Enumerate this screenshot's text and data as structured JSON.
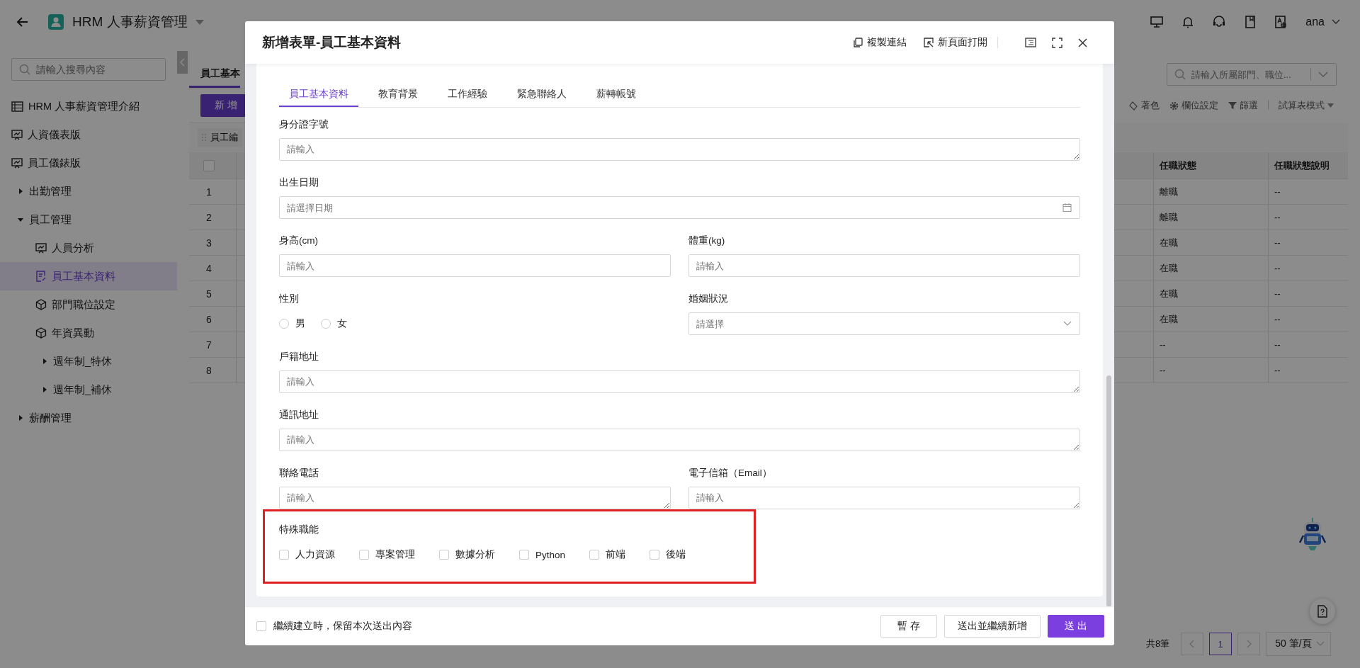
{
  "app_bar": {
    "title": "HRM 人事薪資管理",
    "user": "ana"
  },
  "sidebar": {
    "search_placeholder": "請輸入搜尋內容",
    "items": [
      {
        "label": "HRM 人事薪資管理介紹",
        "kind": "table",
        "selected": false
      },
      {
        "label": "人資儀表版",
        "kind": "dashboard",
        "selected": false
      },
      {
        "label": "員工儀錶版",
        "kind": "dashboard",
        "selected": false
      },
      {
        "label": "出勤管理",
        "kind": "folder",
        "expanded": false
      },
      {
        "label": "員工管理",
        "kind": "folder",
        "expanded": true,
        "children": [
          {
            "label": "人員分析",
            "kind": "dashboard",
            "selected": false
          },
          {
            "label": "員工基本資料",
            "kind": "form",
            "selected": true
          },
          {
            "label": "部門職位設定",
            "kind": "cube",
            "selected": false
          },
          {
            "label": "年資異動",
            "kind": "cube",
            "selected": false
          },
          {
            "label": "週年制_特休",
            "kind": "folder",
            "expanded": false
          },
          {
            "label": "週年制_補休",
            "kind": "folder",
            "expanded": false
          }
        ]
      },
      {
        "label": "薪酬管理",
        "kind": "folder",
        "expanded": false
      }
    ]
  },
  "background": {
    "tab": "員工基本",
    "add_button": "新 增",
    "column_chip": "員工編",
    "row_numbers": [
      "1",
      "2",
      "3",
      "4",
      "5",
      "6",
      "7",
      "8"
    ],
    "search_placeholder": "請輸入所屬部門、職位...",
    "select_all": {
      "checked": false
    },
    "toolbar": [
      {
        "label": "著色",
        "kind": "paint"
      },
      {
        "label": "欄位設定",
        "kind": "gear"
      },
      {
        "label": "篩選",
        "kind": "filter"
      },
      {
        "label": "試算表模式",
        "kind": "dropdown"
      }
    ],
    "table": {
      "columns": [
        "任職狀態",
        "任職狀態說明"
      ],
      "rows": [
        [
          "離職",
          "--"
        ],
        [
          "離職",
          "--"
        ],
        [
          "在職",
          "--"
        ],
        [
          "在職",
          "--"
        ],
        [
          "在職",
          "--"
        ],
        [
          "在職",
          "--"
        ],
        [
          "--",
          "--"
        ],
        [
          "--",
          "--"
        ]
      ]
    },
    "pagination": {
      "total": "共8筆",
      "pages": [
        {
          "label": "1",
          "selected": true
        }
      ],
      "page_size": "50 筆/頁"
    }
  },
  "modal": {
    "title": "新增表單-員工基本資料",
    "actions": [
      {
        "label": "複製連結",
        "kind": "copy"
      },
      {
        "label": "新頁面打開",
        "kind": "open"
      }
    ],
    "tabs": [
      {
        "label": "員工基本資料",
        "selected": true
      },
      {
        "label": "教育背景",
        "selected": false
      },
      {
        "label": "工作經驗",
        "selected": false
      },
      {
        "label": "緊急聯絡人",
        "selected": false
      },
      {
        "label": "薪轉帳號",
        "selected": false
      }
    ],
    "rows": [
      [
        {
          "label": "身分證字號",
          "kind": "textarea",
          "placeholder": "請輸入"
        }
      ],
      [
        {
          "label": "出生日期",
          "kind": "date",
          "placeholder": "請選擇日期"
        }
      ],
      [
        {
          "label": "身高(cm)",
          "kind": "input",
          "placeholder": "請輸入"
        },
        {
          "label": "體重(kg)",
          "kind": "input",
          "placeholder": "請輸入"
        }
      ],
      [
        {
          "label": "性別",
          "kind": "radio",
          "options": [
            {
              "label": "男",
              "selected": false
            },
            {
              "label": "女",
              "selected": false
            }
          ]
        },
        {
          "label": "婚姻狀況",
          "kind": "select",
          "placeholder": "請選擇"
        }
      ],
      [
        {
          "label": "戶籍地址",
          "kind": "textarea",
          "placeholder": "請輸入"
        }
      ],
      [
        {
          "label": "通訊地址",
          "kind": "textarea",
          "placeholder": "請輸入"
        }
      ],
      [
        {
          "label": "聯絡電話",
          "kind": "textarea",
          "placeholder": "請輸入"
        },
        {
          "label": "電子信箱（Email）",
          "kind": "textarea",
          "placeholder": "請輸入"
        }
      ],
      [
        {
          "label": "特殊職能",
          "kind": "checkbox",
          "highlighted": true,
          "options": [
            {
              "label": "人力資源",
              "checked": false
            },
            {
              "label": "專案管理",
              "checked": false
            },
            {
              "label": "數據分析",
              "checked": false
            },
            {
              "label": "Python",
              "checked": false
            },
            {
              "label": "前端",
              "checked": false
            },
            {
              "label": "後端",
              "checked": false
            }
          ]
        }
      ]
    ],
    "footer": {
      "keep": {
        "label": "繼續建立時，保留本次送出內容",
        "checked": false
      },
      "buttons": [
        {
          "label": "暫 存",
          "kind": "default"
        },
        {
          "label": "送出並繼續新增",
          "kind": "default"
        },
        {
          "label": "送 出",
          "kind": "primary"
        }
      ]
    }
  }
}
